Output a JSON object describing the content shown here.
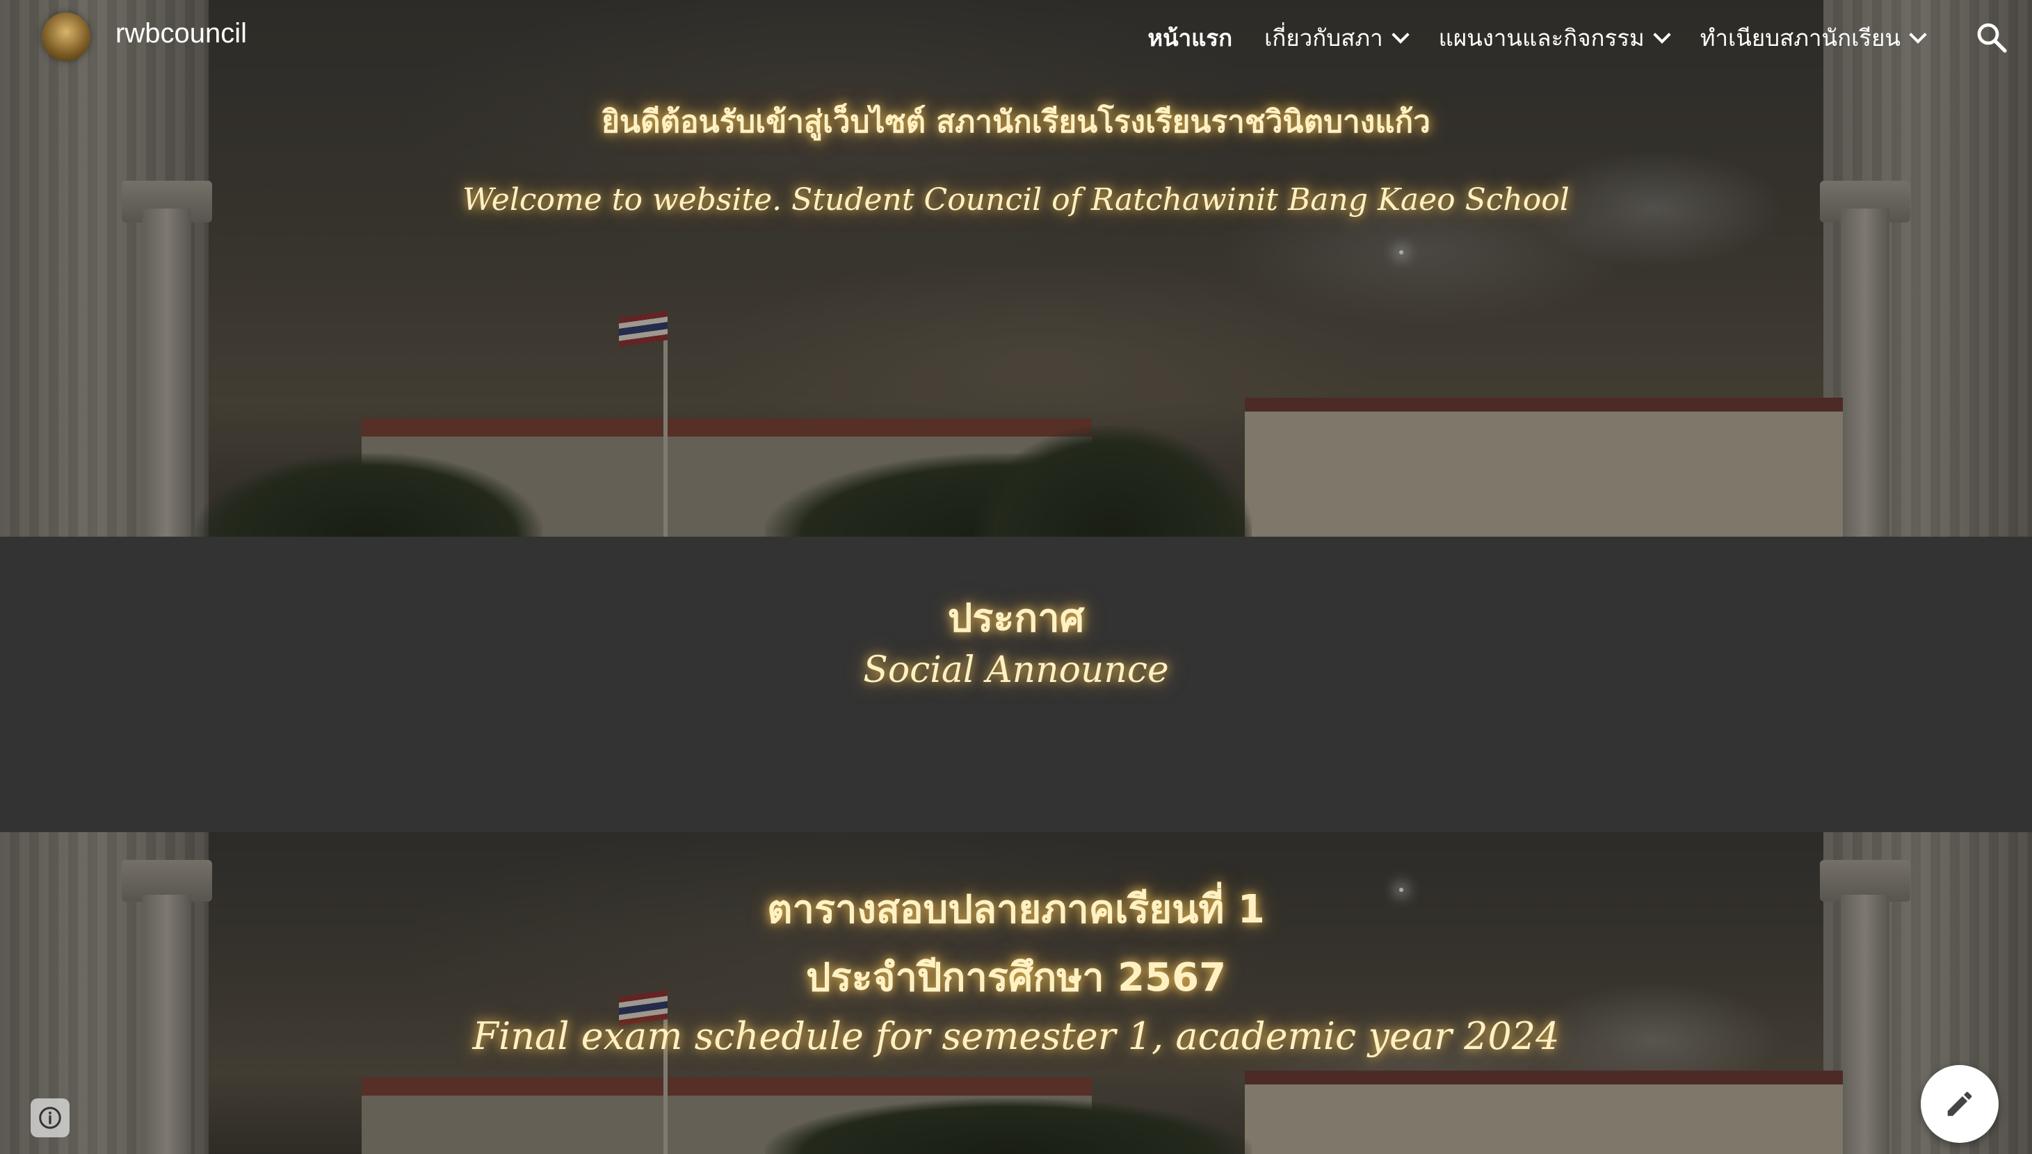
{
  "header": {
    "site_title": "rwbcouncil",
    "logo_icon": "school-emblem-icon",
    "nav": [
      {
        "label": "หน้าแรก",
        "active": true,
        "dropdown": false
      },
      {
        "label": "เกี่ยวกับสภา",
        "active": false,
        "dropdown": true
      },
      {
        "label": "แผนงานและกิจกรรม",
        "active": false,
        "dropdown": true
      },
      {
        "label": "ทำเนียบสภานักเรียน",
        "active": false,
        "dropdown": true
      }
    ],
    "search_icon": "search-icon"
  },
  "hero": {
    "title_th": "ยินดีต้อนรับเข้าสู่เว็บไซต์ สภานักเรียนโรงเรียนราชวินิตบางแก้ว",
    "title_en": "Welcome to website. Student Council of Ratchawinit Bang Kaeo School"
  },
  "announce": {
    "title_th": "ประกาศ",
    "title_en": "Social Announce"
  },
  "exam": {
    "line1": "ตารางสอบปลายภาคเรียนที่ 1",
    "line2": "ประจำปีการศึกษา 2567",
    "line3": "Final exam schedule for semester 1, academic year 2024"
  },
  "floating": {
    "info_icon": "info-icon",
    "edit_icon": "pencil-edit-icon"
  },
  "colors": {
    "glow_text": "#fff1c4",
    "band": "#333333",
    "nav_text": "#ffffff"
  }
}
